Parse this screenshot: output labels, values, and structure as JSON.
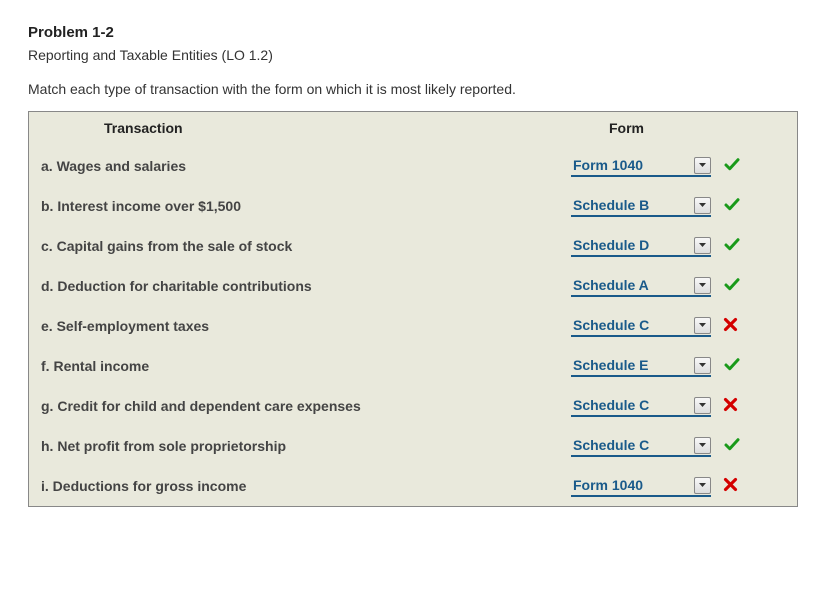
{
  "problem": {
    "title": "Problem 1-2",
    "subtitle": "Reporting and Taxable Entities (LO 1.2)",
    "instruction": "Match each type of transaction with the form on which it is most likely reported."
  },
  "headers": {
    "transaction": "Transaction",
    "form": "Form"
  },
  "rows": [
    {
      "letter": "a.",
      "text": "Wages and salaries",
      "selected": "Form 1040",
      "status": "correct"
    },
    {
      "letter": "b.",
      "text": "Interest income over $1,500",
      "selected": "Schedule B",
      "status": "correct"
    },
    {
      "letter": "c.",
      "text": "Capital gains from the sale of stock",
      "selected": "Schedule D",
      "status": "correct"
    },
    {
      "letter": "d.",
      "text": "Deduction for charitable contributions",
      "selected": "Schedule A",
      "status": "correct"
    },
    {
      "letter": "e.",
      "text": "Self-employment taxes",
      "selected": "Schedule C",
      "status": "wrong"
    },
    {
      "letter": "f.",
      "text": "Rental income",
      "selected": "Schedule E",
      "status": "correct"
    },
    {
      "letter": "g.",
      "text": "Credit for child and dependent care expenses",
      "selected": "Schedule C",
      "status": "wrong"
    },
    {
      "letter": "h.",
      "text": "Net profit from sole proprietorship",
      "selected": "Schedule C",
      "status": "correct"
    },
    {
      "letter": "i.",
      "text": "Deductions for gross income",
      "selected": "Form 1040",
      "status": "wrong"
    }
  ],
  "icons": {
    "correct": "✔",
    "wrong": "✘"
  }
}
